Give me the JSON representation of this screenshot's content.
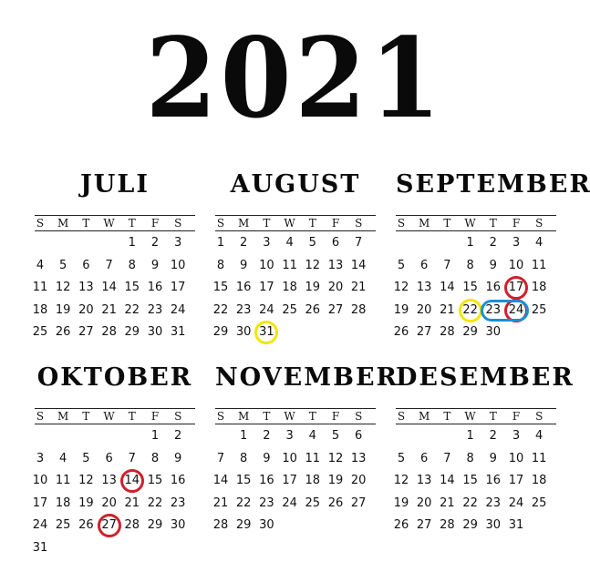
{
  "year": "2021",
  "weekdays": [
    "S",
    "M",
    "T",
    "W",
    "T",
    "F",
    "S"
  ],
  "months": [
    {
      "name": "JULI",
      "weeks": [
        [
          "",
          "",
          "",
          "",
          "1",
          "2",
          "3"
        ],
        [
          "4",
          "5",
          "6",
          "7",
          "8",
          "9",
          "10"
        ],
        [
          "11",
          "12",
          "13",
          "14",
          "15",
          "16",
          "17"
        ],
        [
          "18",
          "19",
          "20",
          "21",
          "22",
          "23",
          "24"
        ],
        [
          "25",
          "26",
          "27",
          "28",
          "29",
          "30",
          "31"
        ]
      ],
      "marks": []
    },
    {
      "name": "AUGUST",
      "weeks": [
        [
          "1",
          "2",
          "3",
          "4",
          "5",
          "6",
          "7"
        ],
        [
          "8",
          "9",
          "10",
          "11",
          "12",
          "13",
          "14"
        ],
        [
          "15",
          "16",
          "17",
          "18",
          "19",
          "20",
          "21"
        ],
        [
          "22",
          "23",
          "24",
          "25",
          "26",
          "27",
          "28"
        ],
        [
          "29",
          "30",
          "31",
          "",
          "",
          "",
          ""
        ]
      ],
      "marks": [
        {
          "day": "31",
          "color": "#f2e600"
        }
      ]
    },
    {
      "name": "SEPTEMBER",
      "weeks": [
        [
          "",
          "",
          "",
          "1",
          "2",
          "3",
          "4"
        ],
        [
          "5",
          "6",
          "7",
          "8",
          "9",
          "10",
          "11"
        ],
        [
          "12",
          "13",
          "14",
          "15",
          "16",
          "17",
          "18"
        ],
        [
          "19",
          "20",
          "21",
          "22",
          "23",
          "24",
          "25"
        ],
        [
          "26",
          "27",
          "28",
          "29",
          "30",
          "",
          ""
        ]
      ],
      "marks": [
        {
          "day": "17",
          "color": "#d0202a"
        },
        {
          "day": "22",
          "color": "#f2e600"
        },
        {
          "day": "24",
          "color": "#d0202a"
        },
        {
          "day": "23-24",
          "color": "#1a8fd6"
        }
      ]
    },
    {
      "name": "OKTOBER",
      "weeks": [
        [
          "",
          "",
          "",
          "",
          "",
          "1",
          "2"
        ],
        [
          "3",
          "4",
          "5",
          "6",
          "7",
          "8",
          "9"
        ],
        [
          "10",
          "11",
          "12",
          "13",
          "14",
          "15",
          "16"
        ],
        [
          "17",
          "18",
          "19",
          "20",
          "21",
          "22",
          "23"
        ],
        [
          "24",
          "25",
          "26",
          "27",
          "28",
          "29",
          "30"
        ],
        [
          "31",
          "",
          "",
          "",
          "",
          "",
          ""
        ]
      ],
      "marks": [
        {
          "day": "14",
          "color": "#d0202a"
        },
        {
          "day": "27",
          "color": "#d0202a"
        }
      ]
    },
    {
      "name": "NOVEMBER",
      "weeks": [
        [
          "",
          "1",
          "2",
          "3",
          "4",
          "5",
          "6"
        ],
        [
          "7",
          "8",
          "9",
          "10",
          "11",
          "12",
          "13"
        ],
        [
          "14",
          "15",
          "16",
          "17",
          "18",
          "19",
          "20"
        ],
        [
          "21",
          "22",
          "23",
          "24",
          "25",
          "26",
          "27"
        ],
        [
          "28",
          "29",
          "30",
          "",
          "",
          "",
          ""
        ]
      ],
      "marks": []
    },
    {
      "name": "DESEMBER",
      "weeks": [
        [
          "",
          "",
          "",
          "1",
          "2",
          "3",
          "4"
        ],
        [
          "5",
          "6",
          "7",
          "8",
          "9",
          "10",
          "11"
        ],
        [
          "12",
          "13",
          "14",
          "15",
          "16",
          "17",
          "18"
        ],
        [
          "19",
          "20",
          "21",
          "22",
          "23",
          "24",
          "25"
        ],
        [
          "26",
          "27",
          "28",
          "29",
          "30",
          "31",
          ""
        ]
      ],
      "marks": []
    }
  ]
}
